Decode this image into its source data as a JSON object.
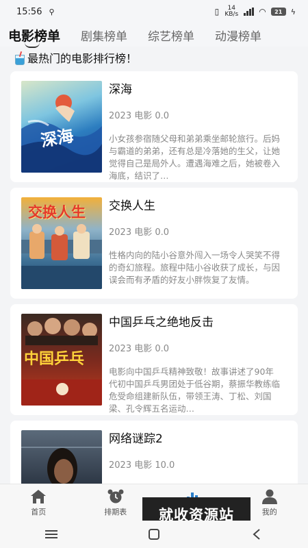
{
  "status_bar": {
    "time": "15:56",
    "net_speed": "14 KB/s",
    "battery": "21"
  },
  "tabs": [
    {
      "label": "电影榜单",
      "active": true
    },
    {
      "label": "剧集榜单",
      "active": false
    },
    {
      "label": "综艺榜单",
      "active": false
    },
    {
      "label": "动漫榜单",
      "active": false
    }
  ],
  "headline": "最热门的电影排行榜！",
  "movies": [
    {
      "title": "深海",
      "meta": "2023 电影 0.0",
      "desc": "小女孩参宿随父母和弟弟乘坐邮轮旅行。后妈与霸道的弟弟，还有总是冷落她的生父，让她觉得自己是局外人。遭遇海难之后，她被卷入海底，结识了…",
      "poster_text": "深海"
    },
    {
      "title": "交换人生",
      "meta": "2023 电影 0.0",
      "desc": "性格内向的陆小谷意外闯入一场令人哭笑不得的奇幻旅程。旅程中陆小谷收获了成长，与因误会而有矛盾的好友小胖恢复了友情。",
      "poster_text": "交换人生"
    },
    {
      "title": "中国乒乓之绝地反击",
      "meta": "2023 电影 0.0",
      "desc": "电影向中国乒乓精神致敬！故事讲述了90年代初中国乒乓男团处于低谷期，蔡振华教练临危受命组建新队伍，带领王涛、丁松、刘国梁、孔令辉五名运动…",
      "poster_text": "中国乒乓"
    },
    {
      "title": "网络谜踪2",
      "meta": "2023 电影 10.0",
      "desc": "",
      "poster_text": ""
    }
  ],
  "bottom_nav": [
    {
      "label": "首页",
      "icon": "home-icon"
    },
    {
      "label": "排期表",
      "icon": "alarm-clock-icon"
    },
    {
      "label": "",
      "icon": "bar-chart-icon"
    },
    {
      "label": "我的",
      "icon": "person-icon"
    }
  ],
  "watermark": "就收资源站"
}
